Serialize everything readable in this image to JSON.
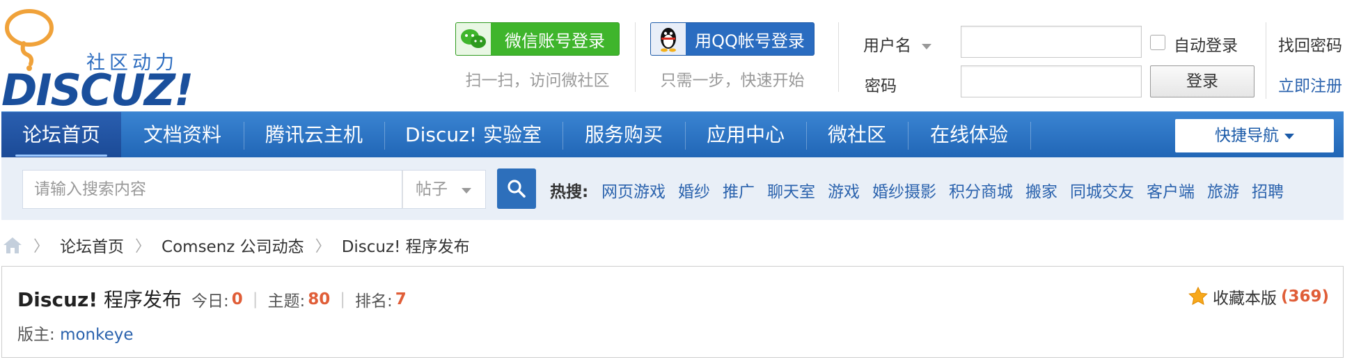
{
  "logo": {
    "tagline": "社区动力",
    "wordmark": "DISCUZ!"
  },
  "social_login": {
    "wechat": {
      "button_label": "微信账号登录",
      "sub_text": "扫一扫，访问微社区",
      "icon": "wechat-icon",
      "color": "#3fb52c"
    },
    "qq": {
      "button_label": "用QQ帐号登录",
      "sub_text": "只需一步，快速开始",
      "icon": "qq-penguin-icon",
      "color": "#2a6cc0"
    }
  },
  "login": {
    "username_label": "用户名",
    "username_value": "",
    "password_label": "密码",
    "password_value": "",
    "auto_login_label": "自动登录",
    "login_button": "登录",
    "forgot_password": "找回密码",
    "register": "立即注册"
  },
  "nav": {
    "items": [
      {
        "label": "论坛首页",
        "active": true
      },
      {
        "label": "文档资料",
        "active": false
      },
      {
        "label": "腾讯云主机",
        "active": false
      },
      {
        "label": "Discuz! 实验室",
        "active": false
      },
      {
        "label": "服务购买",
        "active": false
      },
      {
        "label": "应用中心",
        "active": false
      },
      {
        "label": "微社区",
        "active": false
      },
      {
        "label": "在线体验",
        "active": false
      }
    ],
    "quick_nav": "快捷导航"
  },
  "search": {
    "placeholder": "请输入搜索内容",
    "type_selected": "帖子",
    "hot_label": "热搜:",
    "hot_terms": [
      "网页游戏",
      "婚纱",
      "推广",
      "聊天室",
      "游戏",
      "婚纱摄影",
      "积分商城",
      "搬家",
      "同城交友",
      "客户端",
      "旅游",
      "招聘"
    ]
  },
  "breadcrumb": [
    "论坛首页",
    "Comsenz 公司动态",
    "Discuz! 程序发布"
  ],
  "forum": {
    "title_bold": "Discuz!",
    "title_rest": " 程序发布",
    "today_label": "今日:",
    "today_value": "0",
    "topics_label": "主题:",
    "topics_value": "80",
    "rank_label": "排名:",
    "rank_value": "7",
    "moderator_label": "版主:",
    "moderator_name": "monkeye",
    "favorite_label": "收藏本版",
    "favorite_count": "(369)"
  },
  "colors": {
    "accent_blue": "#2166b6",
    "link_blue": "#2a62ad",
    "number_orange": "#e05e38"
  }
}
